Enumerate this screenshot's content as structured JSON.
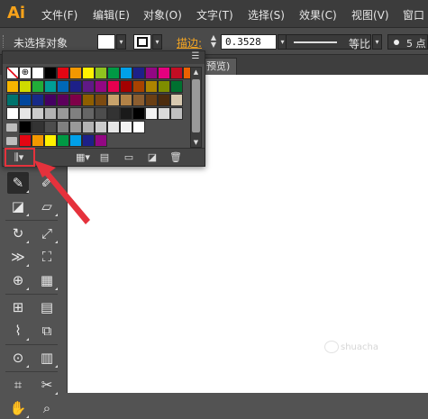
{
  "app": {
    "logo": "Ai"
  },
  "menu": {
    "items": [
      "文件(F)",
      "编辑(E)",
      "对象(O)",
      "文字(T)",
      "选择(S)",
      "效果(C)",
      "视图(V)",
      "窗口"
    ]
  },
  "control_bar": {
    "selection_status": "未选择对象",
    "stroke_label": "描边:",
    "stroke_value": "0.3528",
    "profile_label": "等比",
    "brush_label": "5 点"
  },
  "document_tab": {
    "label": "预览)"
  },
  "swatch_panel": {
    "menu_icon": "panel-menu-icon",
    "rows": [
      [
        "none",
        "registration",
        "#ffffff",
        "#000000",
        "#e30613",
        "#f39800",
        "#fff100",
        "#8fc31f",
        "#009944",
        "#00a0e9",
        "#1d2088",
        "#920783",
        "#e4007f",
        "#c30d23",
        "#eb6100"
      ],
      [
        "#f8b500",
        "#cfdb00",
        "#22ac38",
        "#009e96",
        "#0068b7",
        "#1d2088",
        "#601986",
        "#920783",
        "#e5004f",
        "#a40000",
        "#a84200",
        "#ad8400",
        "#7e8d00",
        "#007130"
      ],
      [
        "#00736d",
        "#00479d",
        "#172a88",
        "#440062",
        "#5d005c",
        "#7e0048",
        "#8f5e00",
        "#7c4a10",
        "#c7a26b",
        "#b28247",
        "#8c5e30",
        "#6a3f14",
        "#4c2c0e",
        "#d7c9b0"
      ],
      [
        "#ffffff",
        "#e6e6e6",
        "#cccccc",
        "#b3b3b3",
        "#999999",
        "#808080",
        "#666666",
        "#4d4d4d",
        "#333333",
        "#1a1a1a",
        "#000000",
        "#f2f2f2",
        "#d9d9d9",
        "#bfbfbf"
      ],
      [
        "#000000",
        "#333333",
        "#4d4d4d",
        "#808080",
        "#999999",
        "#b3b3b3",
        "#cccccc",
        "#e6e6e6",
        "#f2f2f2",
        "#ffffff"
      ],
      [
        "#e30613",
        "#f39800",
        "#fff100",
        "#009944",
        "#00a0e9",
        "#1d2088",
        "#920783"
      ]
    ]
  },
  "colors": {
    "accent": "#f5a623",
    "highlight_box": "#e5323c",
    "menubar": "#3c3c3c",
    "canvas": "#ffffff"
  },
  "watermark": {
    "text": "shuacha"
  }
}
